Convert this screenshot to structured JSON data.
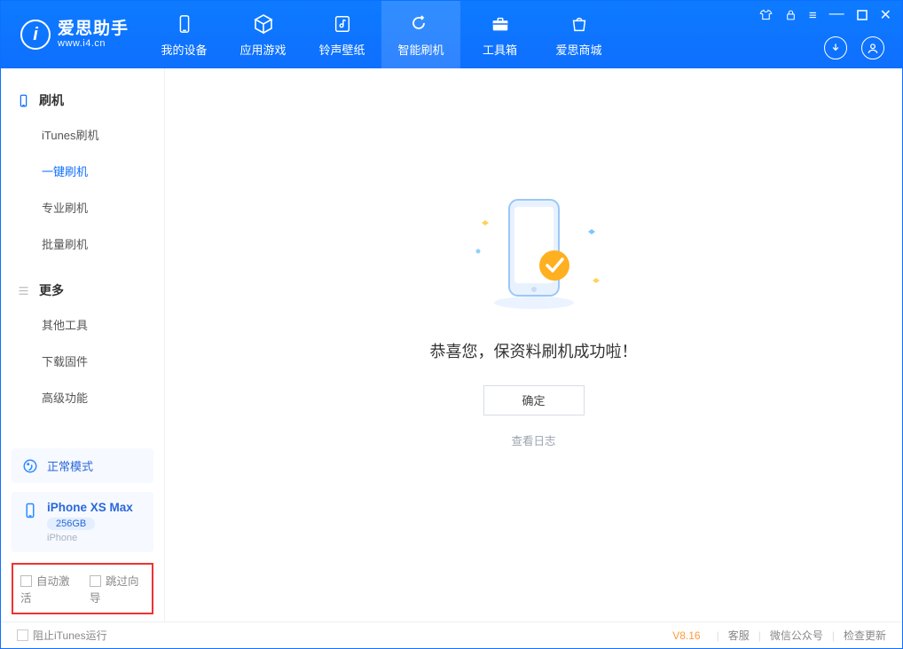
{
  "app": {
    "logo_letter": "i",
    "title": "爱思助手",
    "subtitle": "www.i4.cn"
  },
  "nav": {
    "items": [
      {
        "label": "我的设备",
        "icon": "device-icon"
      },
      {
        "label": "应用游戏",
        "icon": "cube-icon"
      },
      {
        "label": "铃声壁纸",
        "icon": "music-icon"
      },
      {
        "label": "智能刷机",
        "icon": "refresh-icon",
        "active": true
      },
      {
        "label": "工具箱",
        "icon": "toolbox-icon"
      },
      {
        "label": "爱思商城",
        "icon": "store-icon"
      }
    ]
  },
  "sidebar": {
    "group1": {
      "title": "刷机",
      "items": [
        {
          "label": "iTunes刷机"
        },
        {
          "label": "一键刷机",
          "active": true
        },
        {
          "label": "专业刷机"
        },
        {
          "label": "批量刷机"
        }
      ]
    },
    "group2": {
      "title": "更多",
      "items": [
        {
          "label": "其他工具"
        },
        {
          "label": "下载固件"
        },
        {
          "label": "高级功能"
        }
      ]
    },
    "mode_box": {
      "label": "正常模式"
    },
    "device_box": {
      "name": "iPhone XS Max",
      "capacity": "256GB",
      "type": "iPhone"
    },
    "checks": {
      "auto_activate": "自动激活",
      "skip_wizard": "跳过向导"
    }
  },
  "main": {
    "success_msg": "恭喜您，保资料刷机成功啦！",
    "ok_label": "确定",
    "log_link": "查看日志"
  },
  "footer": {
    "block_itunes": "阻止iTunes运行",
    "version": "V8.16",
    "links": {
      "kefu": "客服",
      "wechat": "微信公众号",
      "update": "检查更新"
    }
  }
}
